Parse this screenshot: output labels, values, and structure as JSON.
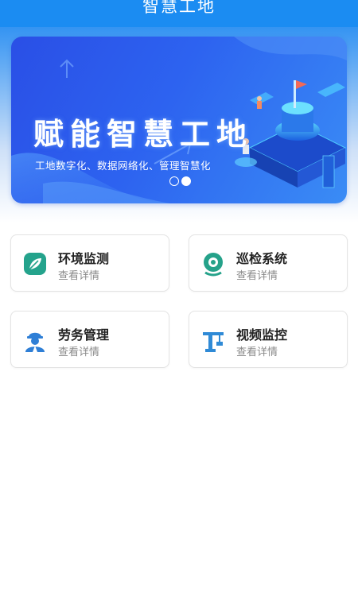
{
  "header": {
    "title": "智慧工地"
  },
  "banner": {
    "title": "赋能智慧工地",
    "subtitle": "工地数字化、数据网络化、管理智慧化",
    "slides": 2,
    "active_slide": 2
  },
  "cards": [
    {
      "title": "环境监测",
      "subtitle": "查看详情",
      "icon": "leaf-icon",
      "color": "#24a38c"
    },
    {
      "title": "巡检系统",
      "subtitle": "查看详情",
      "icon": "camera-inspection-icon",
      "color": "#25a28a"
    },
    {
      "title": "劳务管理",
      "subtitle": "查看详情",
      "icon": "worker-icon",
      "color": "#2f7fd6"
    },
    {
      "title": "视频监控",
      "subtitle": "查看详情",
      "icon": "crane-icon",
      "color": "#2f8ad6"
    }
  ],
  "colors": {
    "primary": "#1b8cf2",
    "banner": "#2d63f0"
  }
}
